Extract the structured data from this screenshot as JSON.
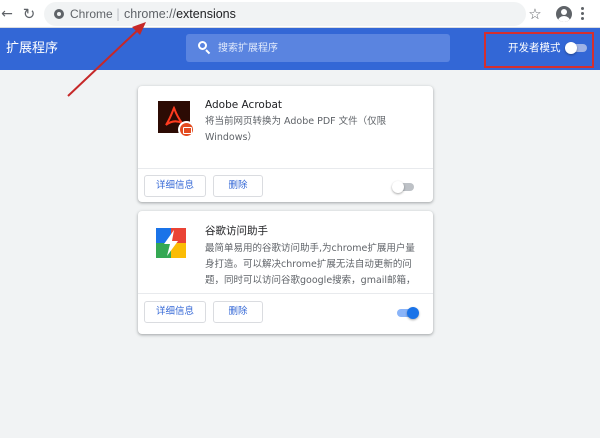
{
  "browser": {
    "site_chip": "Chrome",
    "url_scheme": "chrome://",
    "url_rest": "extensions"
  },
  "header": {
    "title": "扩展程序",
    "search_placeholder": "搜索扩展程序",
    "dev_mode_label": "开发者模式",
    "dev_mode_on": false
  },
  "extensions": [
    {
      "name": "Adobe Acrobat",
      "desc_line1": "将当前网页转换为 Adobe PDF 文件（仅限",
      "desc_line2": "Windows）",
      "details_label": "详细信息",
      "remove_label": "删除",
      "enabled": false
    },
    {
      "name": "谷歌访问助手",
      "desc_line1": "最简单易用的谷歌访问助手,为chrome扩展用户量",
      "desc_line2": "身打造。可以解决chrome扩展无法自动更新的问",
      "desc_line3": "题，同时可以访问谷歌google搜索，gmail邮箱，",
      "details_label": "详细信息",
      "remove_label": "删除",
      "enabled": true
    }
  ],
  "colors": {
    "header_blue": "#3367d6",
    "annotation_red": "#d32f2f",
    "toggle_on": "#1a73e8"
  }
}
